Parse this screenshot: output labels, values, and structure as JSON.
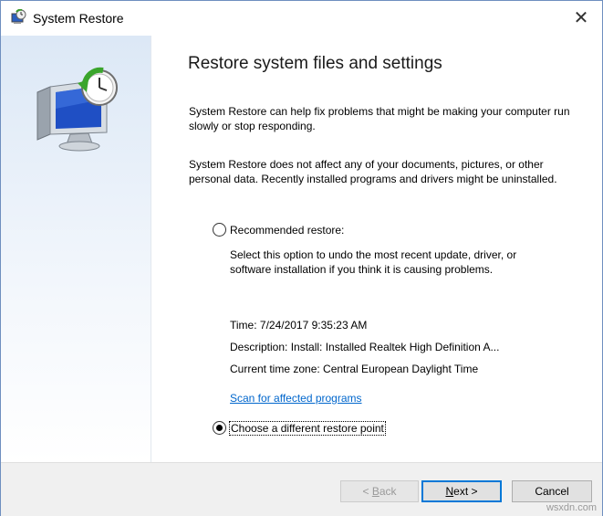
{
  "window": {
    "title": "System Restore",
    "close_glyph": "✕"
  },
  "main": {
    "heading": "Restore system files and settings",
    "para1": "System Restore can help fix problems that might be making your computer run slowly or stop responding.",
    "para2": "System Restore does not affect any of your documents, pictures, or other personal data. Recently installed programs and drivers might be uninstalled.",
    "recommended": {
      "label": "Recommended restore:",
      "selected": false,
      "description": "Select this option to undo the most recent update, driver, or software installation if you think it is causing problems."
    },
    "details": {
      "time": "Time: 7/24/2017 9:35:23 AM",
      "description": "Description: Install: Installed Realtek High Definition A...",
      "timezone": "Current time zone: Central European Daylight Time"
    },
    "scan_link": "Scan for affected programs",
    "different": {
      "label": "Choose a different restore point",
      "selected": true
    }
  },
  "footer": {
    "back_prefix": "< ",
    "back_hotkey": "B",
    "back_rest": "ack",
    "next_hotkey": "N",
    "next_rest": "ext >",
    "cancel_label": "Cancel"
  },
  "watermark": "wsxdn.com",
  "colors": {
    "link": "#0066cc",
    "focus_border": "#0078d7",
    "sidebar_top": "#dce8f6"
  },
  "icons": [
    "system-restore-app-icon",
    "close-icon",
    "monitor-clock-restore-icon"
  ]
}
